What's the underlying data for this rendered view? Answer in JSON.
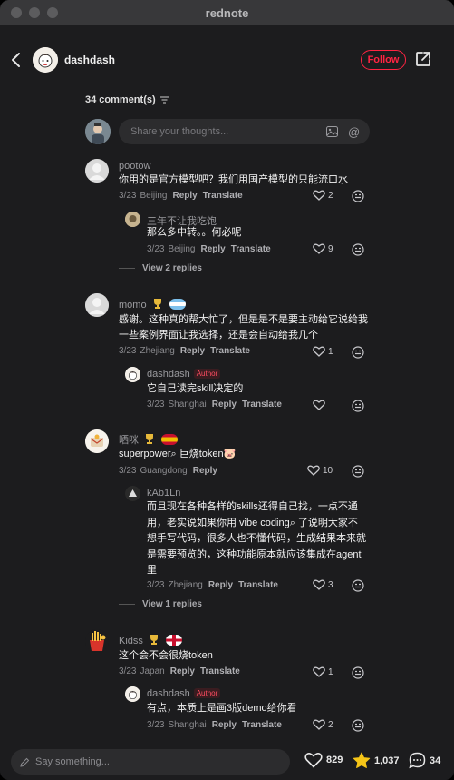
{
  "window": {
    "title": "rednote"
  },
  "header": {
    "author": "dashdash",
    "follow_label": "Follow"
  },
  "comments_count_label": "34 comment(s)",
  "compose": {
    "placeholder": "Share your thoughts..."
  },
  "comments": [
    {
      "name": "pootow",
      "text": "你用的是官方模型吧？我们用国产模型的只能流口水",
      "date": "3/23",
      "location": "Beijing",
      "reply": "Reply",
      "translate": "Translate",
      "likes": "2",
      "replies": [
        {
          "name": "三年不让我吃饱",
          "text": "那么多中转。。何必呢",
          "date": "3/23",
          "location": "Beijing",
          "reply": "Reply",
          "translate": "Translate",
          "likes": "9"
        }
      ],
      "view_replies": "View 2 replies"
    },
    {
      "name": "momo",
      "text_lines": [
        "感谢。这种真的帮大忙了，但是是不是要主动给它说给我",
        "一些案例界面让我选择，还是会自动给我几个"
      ],
      "date": "3/23",
      "location": "Zhejiang",
      "reply": "Reply",
      "translate": "Translate",
      "likes": "1",
      "replies": [
        {
          "name": "dashdash",
          "badge": "Author",
          "text": "它自己读完skill决定的",
          "date": "3/23",
          "location": "Shanghai",
          "reply": "Reply",
          "translate": "Translate",
          "likes": ""
        }
      ]
    },
    {
      "name": "晒咪",
      "text": "superpower⌕ 巨烧token🐷",
      "date": "3/23",
      "location": "Guangdong",
      "reply": "Reply",
      "likes": "10",
      "replies": [
        {
          "name": "kAb1Ln",
          "text_lines": [
            "而且现在各种各样的skills还得自己找，一点不通",
            "用，老实说如果你用 vibe coding⌕ 了说明大家不",
            "想手写代码，很多人也不懂代码，生成结果本来就",
            "是需要预览的，这种功能原本就应该集成在agent",
            "里"
          ],
          "date": "3/23",
          "location": "Zhejiang",
          "reply": "Reply",
          "translate": "Translate",
          "likes": "3"
        }
      ],
      "view_replies": "View 1 replies"
    },
    {
      "name": "Kidss",
      "text": "这个会不会很烧token",
      "date": "3/23",
      "location": "Japan",
      "reply": "Reply",
      "translate": "Translate",
      "likes": "1",
      "replies": [
        {
          "name": "dashdash",
          "badge": "Author",
          "text": "有点，本质上是画3版demo给你看",
          "date": "3/23",
          "location": "Shanghai",
          "reply": "Reply",
          "translate": "Translate",
          "likes": "2"
        }
      ]
    }
  ],
  "bottom": {
    "say_placeholder": "Say something...",
    "likes": "829",
    "stars": "1,037",
    "comments": "34"
  },
  "colors": {
    "accent": "#ff2442",
    "background": "#1c1c1e"
  }
}
